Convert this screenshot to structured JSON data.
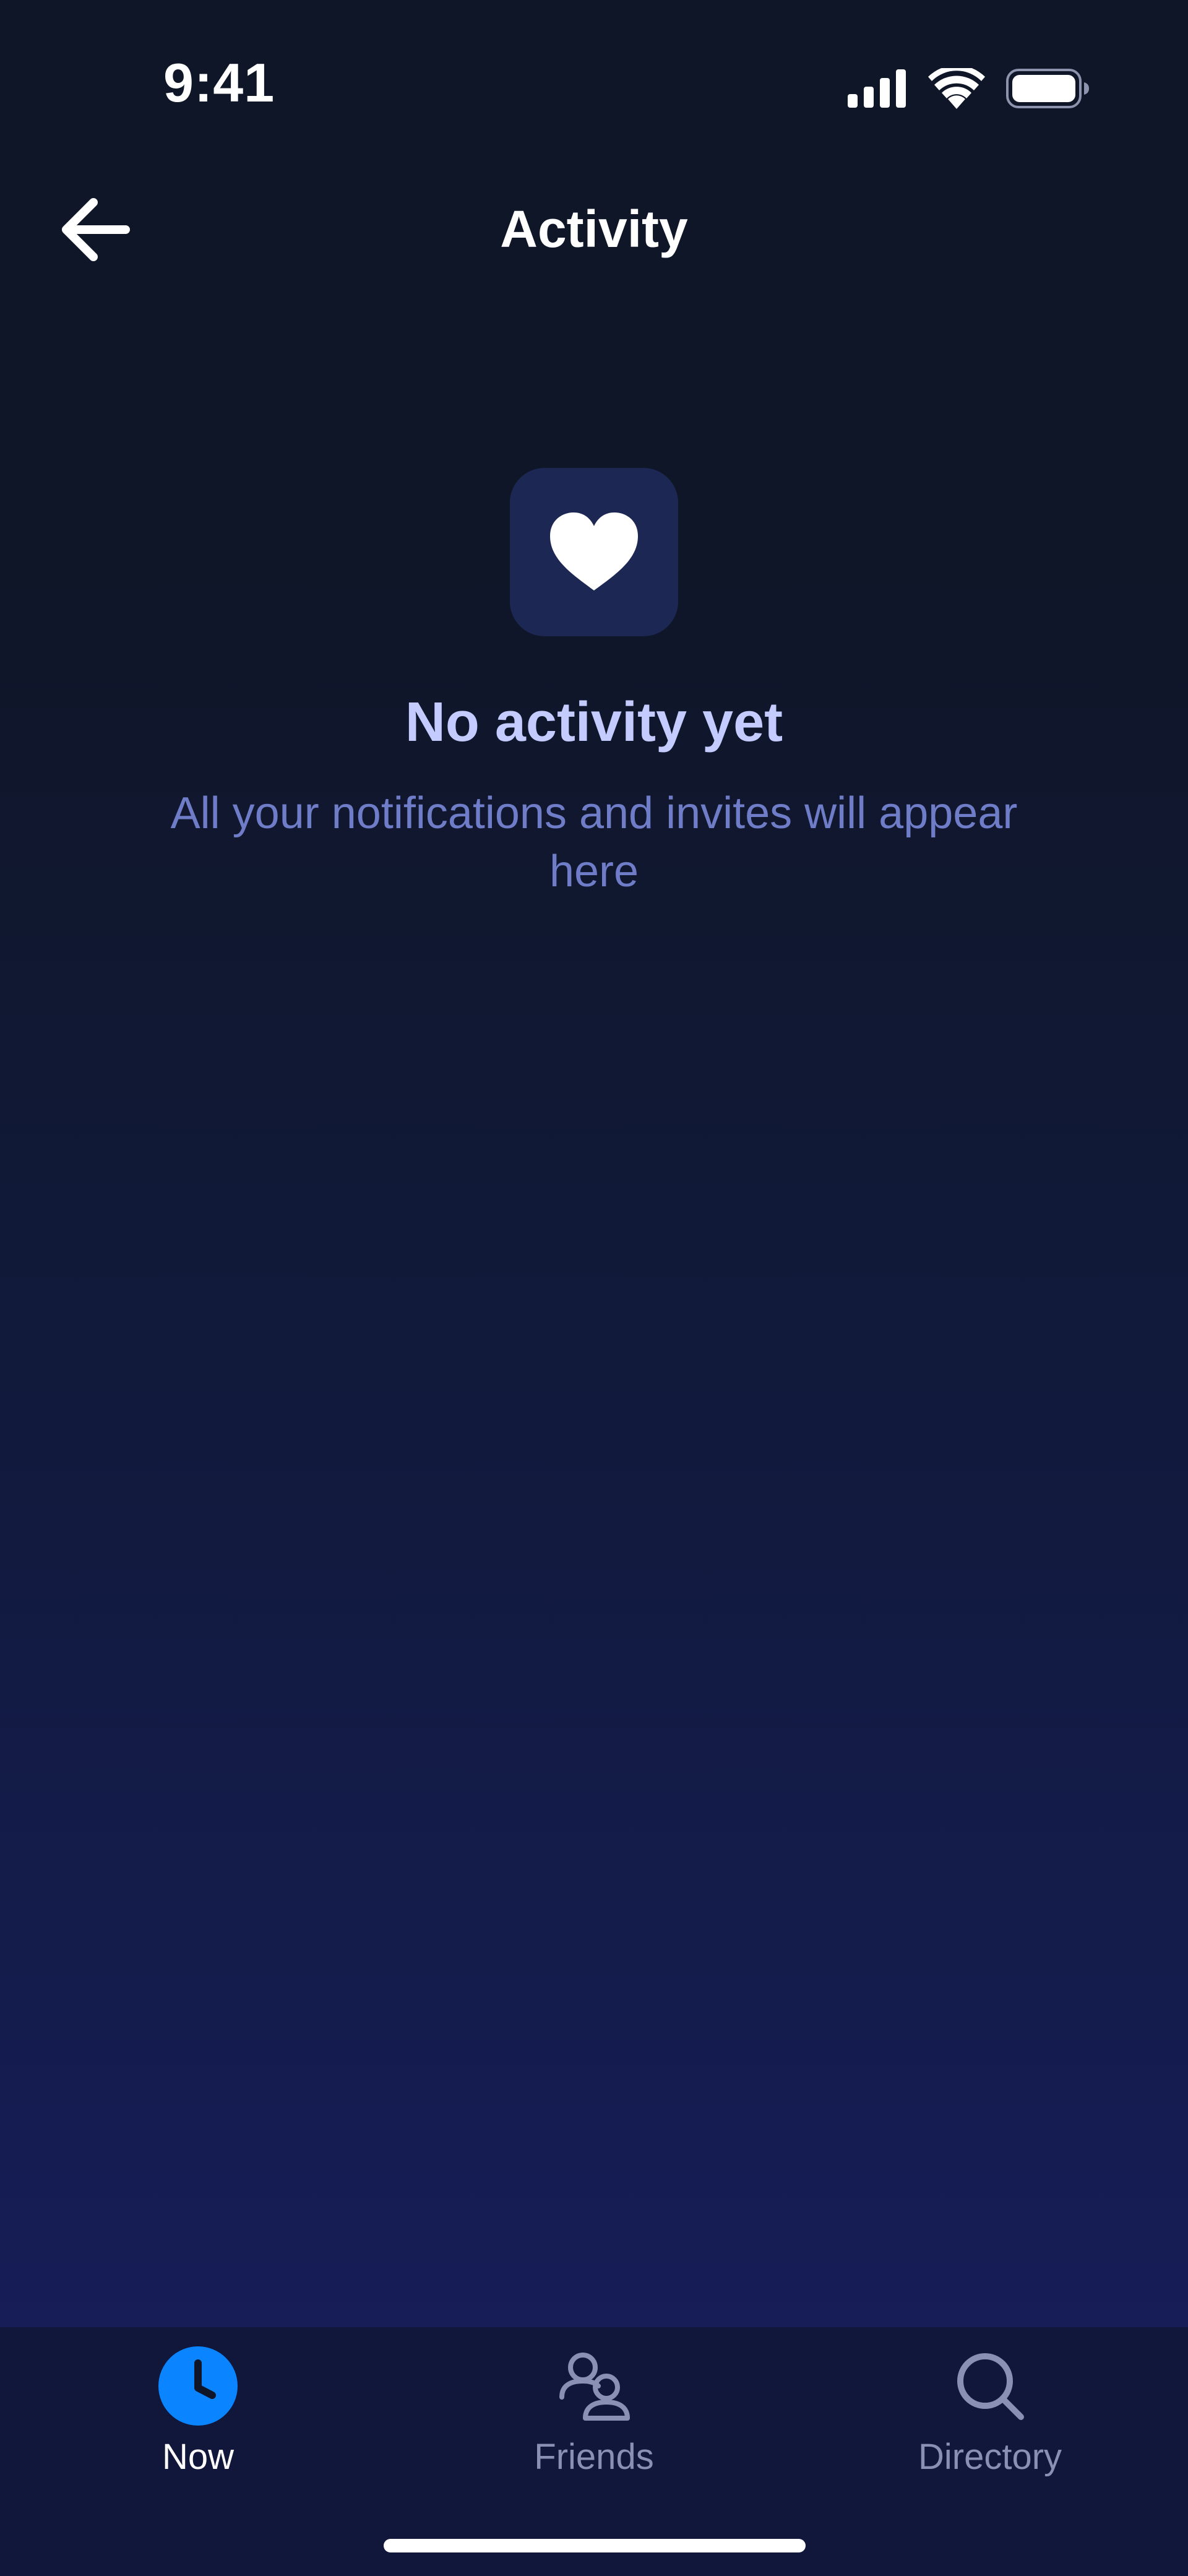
{
  "status_bar": {
    "time": "9:41",
    "icons": [
      "signal-icon",
      "wifi-icon",
      "battery-icon"
    ]
  },
  "header": {
    "back_icon": "arrow-left-icon",
    "title": "Activity"
  },
  "empty_state": {
    "icon": "heart-icon",
    "title": "No activity yet",
    "subtitle": "All your notifications and invites will appear here"
  },
  "tab_bar": {
    "tabs": [
      {
        "label": "Now",
        "icon": "clock-icon",
        "active": true
      },
      {
        "label": "Friends",
        "icon": "friends-icon",
        "active": false
      },
      {
        "label": "Directory",
        "icon": "search-icon",
        "active": false
      }
    ]
  },
  "colors": {
    "accent": "#0a84ff",
    "background_top": "#0f1628",
    "background_bottom": "#161d57",
    "tile": "#1d2754",
    "title_text": "#c3cbff",
    "subtitle_text": "#6f7dc8",
    "tab_bar": "#10173a",
    "inactive_tab": "#8a90b4"
  }
}
